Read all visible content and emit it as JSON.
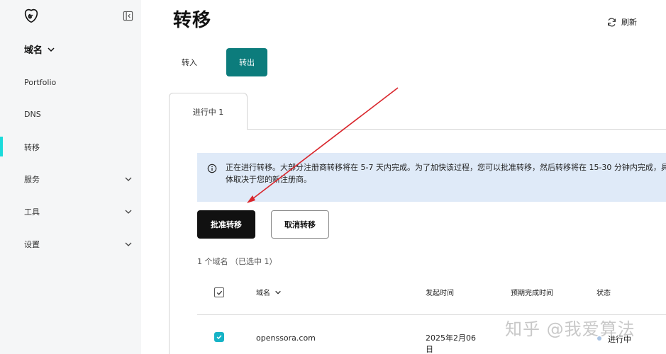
{
  "sidebar": {
    "section_title": "域名",
    "items": [
      {
        "label": "Portfolio",
        "has_chevron": false
      },
      {
        "label": "DNS",
        "has_chevron": false
      },
      {
        "label": "转移",
        "has_chevron": false,
        "active": true
      },
      {
        "label": "服务",
        "has_chevron": true
      },
      {
        "label": "工具",
        "has_chevron": true
      },
      {
        "label": "设置",
        "has_chevron": true
      }
    ]
  },
  "header": {
    "title": "转移",
    "refresh_label": "刷新"
  },
  "segments": {
    "in_label": "转入",
    "out_label": "转出",
    "active": "out"
  },
  "tabs": {
    "active_label": "进行中 1"
  },
  "alert": {
    "text": "正在进行转移。大部分注册商转移将在 5-7 天内完成。为了加快该过程，您可以批准转移，然后转移将在 15-30 分钟内完成，具体取决于您的新注册商。"
  },
  "actions": {
    "approve_label": "批准转移",
    "cancel_label": "取消转移"
  },
  "summary": {
    "count_text": "1 个域名 （已选中 1）"
  },
  "table": {
    "columns": [
      "域名",
      "发起时间",
      "预期完成时间",
      "状态"
    ],
    "rows": [
      {
        "domain": "openssora.com",
        "started": "2025年2月06日",
        "expected": "",
        "status": "进行中"
      }
    ]
  },
  "watermark": "知乎 @我爱算法",
  "colors": {
    "accent_teal": "#0c7c7c",
    "active_bar": "#1bdbdb",
    "alert_bg": "#dfeaf8",
    "checkbox": "#16b3c6",
    "arrow": "#d9262c"
  }
}
